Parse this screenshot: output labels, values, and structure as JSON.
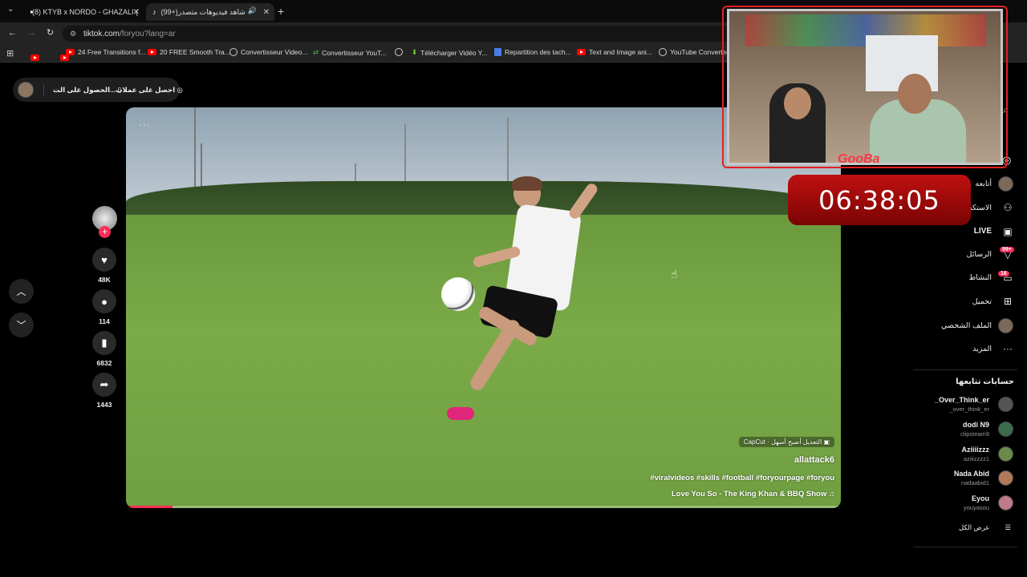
{
  "browser": {
    "tabs": [
      {
        "title": "(8) KTYB x NORDO - GHAZALI (",
        "icon": "youtube-icon"
      },
      {
        "title": "(99+)شاهد فيديوهات متصدر",
        "icon": "tiktok-icon"
      }
    ],
    "address": {
      "host": "tiktok.com",
      "path": "/foryou?lang=ar"
    },
    "bookmarks": [
      "24 Free Transitions f...",
      "20 FREE Smooth Tra...",
      "Convertisseur Video...",
      "Convertisseur YouT...",
      "Télécharger Vidéo Y...",
      "Repartition des tach...",
      "Text and Image ani...",
      "YouTube Converter"
    ]
  },
  "top_chip": {
    "get_coins": "احصل على عملات",
    "get_app": "الحصول على الت..."
  },
  "video": {
    "username": "allattack6",
    "hashtags": "#viralvideos #skills #football #foryourpage #foryou",
    "music": "Love You So - The King Khan & BBQ Show",
    "capcut": "CapCut · التعديل أصبح أسهل",
    "progress": 0.065,
    "more": "..."
  },
  "actions": {
    "likes": "48K",
    "comments": "114",
    "saves": "6832",
    "shares": "1443"
  },
  "overlay": {
    "timer": "06:38:05",
    "cam_label": "GooBa"
  },
  "sidebar": {
    "nav": [
      {
        "label": "أتابعه",
        "icon": "avatar-icon"
      },
      {
        "label": "الاستكشاف",
        "icon": "people-icon"
      },
      {
        "label": "LIVE",
        "icon": "live-icon"
      },
      {
        "label": "الرسائل",
        "icon": "inbox-icon",
        "badge": "99+"
      },
      {
        "label": "النشاط",
        "icon": "activity-icon",
        "badge": "16"
      },
      {
        "label": "تحميل",
        "icon": "upload-icon"
      },
      {
        "label": "الملف الشخصي",
        "icon": "profile-icon"
      },
      {
        "label": "المزيد",
        "icon": "more-icon"
      }
    ],
    "following_title": "حسابات تتابعها",
    "accounts": [
      {
        "name": "_Over_Think_er",
        "handle": "_over_think_er"
      },
      {
        "name": "dodi N9",
        "handle": "clipsteam9"
      },
      {
        "name": "Aziiiizzz",
        "handle": "aziiizzzz1"
      },
      {
        "name": "Nada Abid",
        "handle": "nadaabid1"
      },
      {
        "name": "Eyou",
        "handle": "youyasou"
      }
    ],
    "see_all": "عرض الكل"
  }
}
